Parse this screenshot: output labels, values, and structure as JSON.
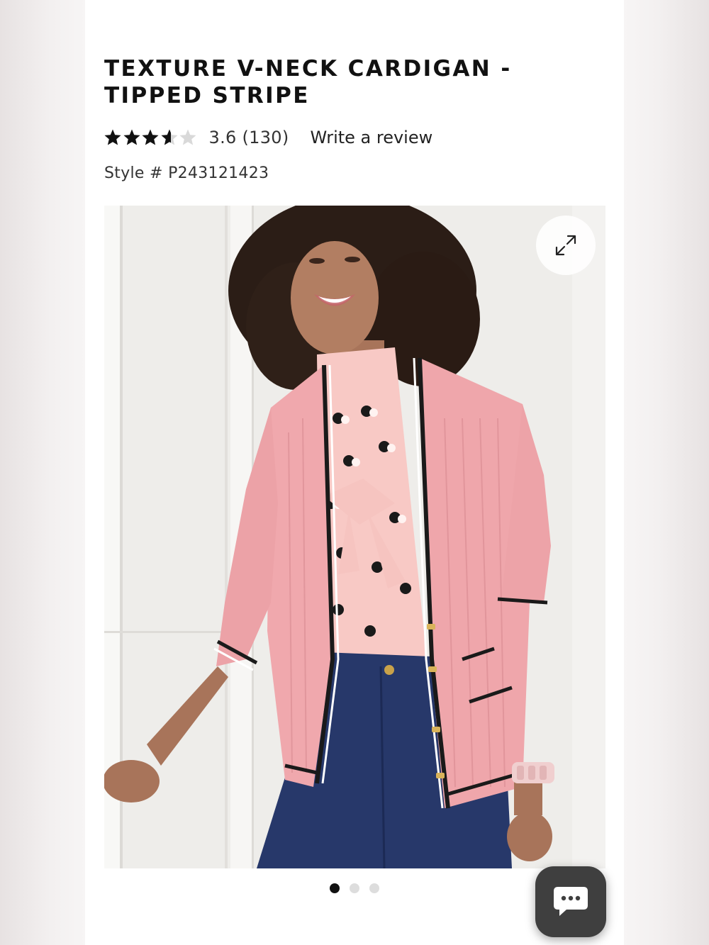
{
  "product": {
    "title": "TEXTURE V-NECK CARDIGAN - TIPPED STRIPE",
    "rating_value": 3.6,
    "rating_max": 5,
    "rating_text": "3.6 (130)",
    "review_link": "Write a review",
    "style_number": "Style # P243121423"
  },
  "gallery": {
    "image_alt": "Model wearing pink ribbed v-neck cardigan with black tipped stripes over a pink polka-dot bow blouse and dark jeans",
    "expand_icon": "expand-arrows-icon",
    "slide_count": 3,
    "active_slide": 1
  },
  "colors": {
    "star_filled": "#111111",
    "star_empty": "#d9d9d9",
    "chat_button": "#3f3f3f",
    "cardigan_pink": "#f0a8ad"
  },
  "chat": {
    "icon": "chat-bubble-icon"
  }
}
